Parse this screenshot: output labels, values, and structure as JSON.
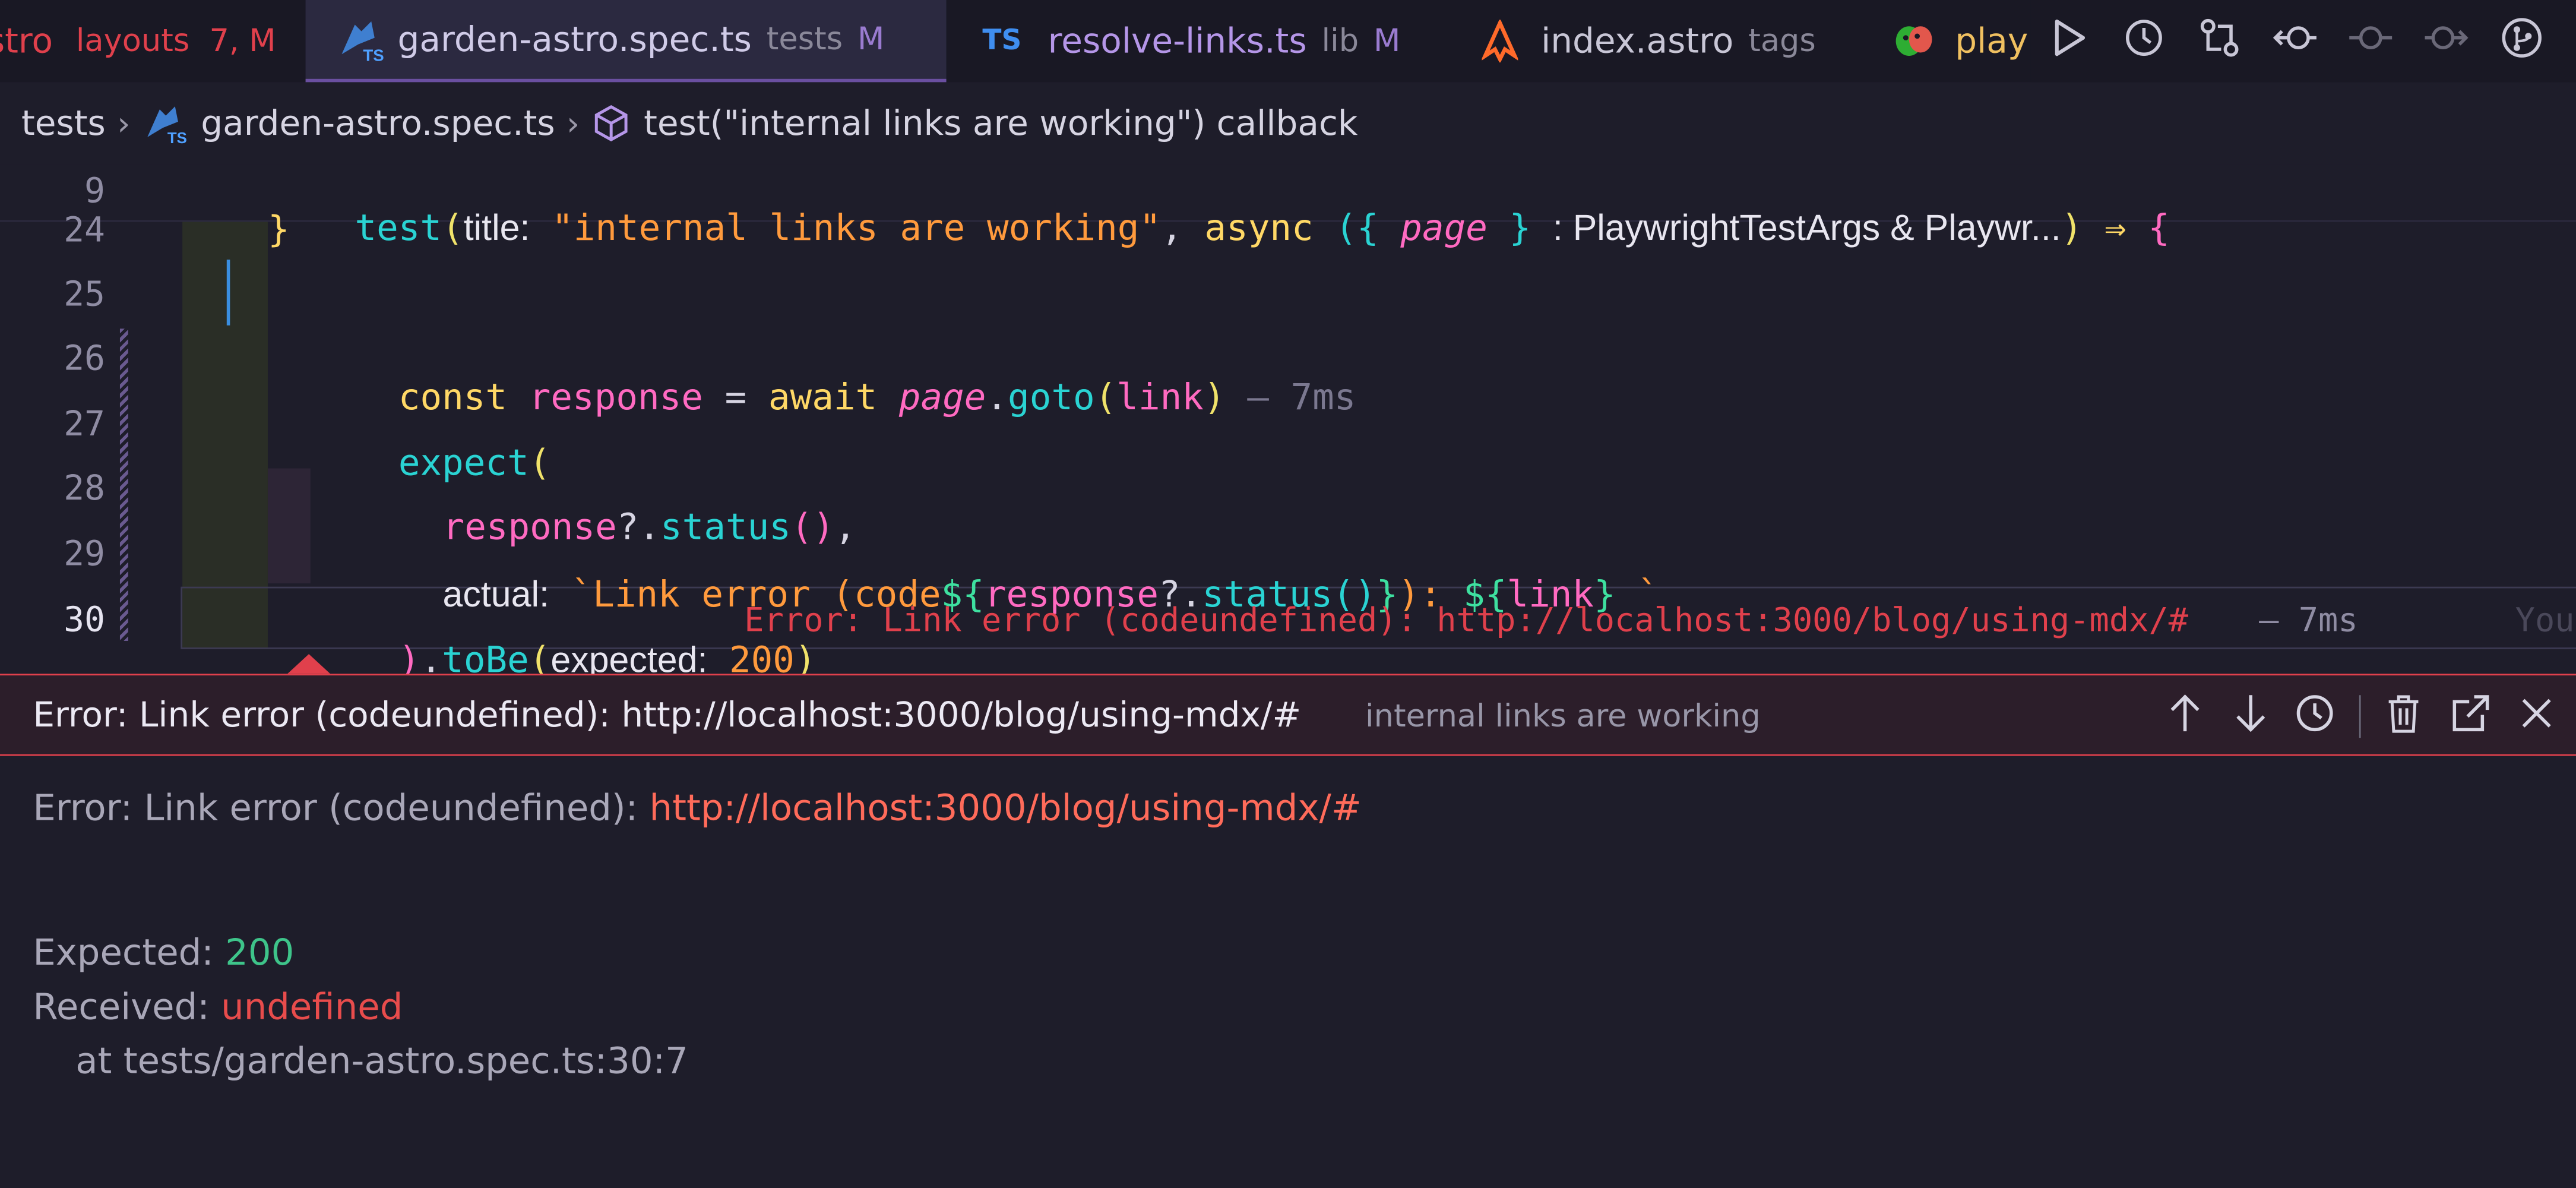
{
  "tabs": [
    {
      "name": "stro",
      "sub": "layouts",
      "flag": "7, M"
    },
    {
      "name": "garden-astro.spec.ts",
      "sub": "tests",
      "flag": "M"
    },
    {
      "badge": "TS",
      "name": "resolve-links.ts",
      "sub": "lib",
      "flag": "M"
    },
    {
      "name": "index.astro",
      "sub": "tags"
    },
    {
      "name": "play"
    }
  ],
  "breadcrumb": {
    "folder": "tests",
    "file": "garden-astro.spec.ts",
    "symbol": "test(\"internal links are working\") callback"
  },
  "sticky": {
    "line": "9",
    "fn": "test",
    "hint_title": "title:",
    "str": "\"internal links are working\"",
    "comma": ",",
    "kw": "async",
    "open": "({",
    "param": "page",
    "close": "}",
    "type_hint": ": PlaywrightTestArgs & Playwr...",
    "rparen": ")",
    "arrow": "⇒",
    "brace": "{"
  },
  "lines": {
    "n24": "24",
    "n25": "25",
    "n26": "26",
    "n27": "27",
    "n28": "28",
    "n29": "29",
    "n30": "30",
    "l24_brace": "}",
    "l26_kw": "const",
    "l26_var": "response",
    "l26_eq": "=",
    "l26_await": "await",
    "l26_page": "page",
    "l26_dot": ".",
    "l26_fn": "goto",
    "l26_open": "(",
    "l26_arg": "link",
    "l26_close": ")",
    "l26_time": "– 7ms",
    "l27_fn": "expect",
    "l27_open": "(",
    "l28_var": "response",
    "l28_q": "?.",
    "l28_fn": "status",
    "l28_call": "()",
    "l28_comma": ",",
    "l29_hint": "actual:",
    "l29_str1": "`Link error (code",
    "l29_dollar": "${",
    "l29_var": "response",
    "l29_q": "?.",
    "l29_fn": "status",
    "l29_call": "()",
    "l29_endb": "}",
    "l29_str2": "): ",
    "l29_dollar2": "${",
    "l29_var2": "link",
    "l29_endb2": "}",
    "l29_str3": " `",
    "l30_close": ")",
    "l30_dot": ".",
    "l30_fn": "toBe",
    "l30_open": "(",
    "l30_hint": "expected:",
    "l30_num": "200",
    "l30_close2": ")",
    "l30_err": "Error: Link error (codeundefined): http://localhost:3000/blog/using-mdx/#",
    "l30_time": "– 7ms",
    "l30_ghost": "You"
  },
  "peek": {
    "title": "Error: Link error (codeundefined): http://localhost:3000/blog/using-mdx/#",
    "test_name": "internal links are working"
  },
  "output": {
    "err_prefix": "Error: Link error (codeundefined): ",
    "err_link": "http://localhost:3000/blog/using-mdx/#",
    "expected_label": "Expected: ",
    "expected_value": "200",
    "received_label": "Received: ",
    "received_value": "undefined",
    "stack": "at tests/garden-astro.spec.ts:30:7"
  },
  "colors": {
    "accent_purple": "#6a4fa0",
    "error_red": "#e0404c",
    "link_red": "#ff6b5a",
    "ok_green": "#3ec48a"
  }
}
